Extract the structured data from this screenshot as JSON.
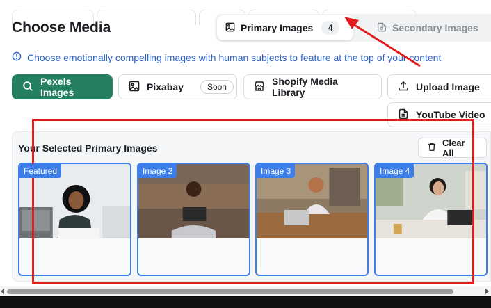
{
  "header": {
    "title": "Choose Media",
    "tabs": {
      "primary_label": "Primary Images",
      "primary_count": "4",
      "secondary_label": "Secondary Images"
    }
  },
  "info": {
    "text": "Choose emotionally compelling images with human subjects to feature at the top of your content"
  },
  "sources": {
    "pexels": "Pexels Images",
    "pixabay": "Pixabay",
    "pixabay_badge": "Soon",
    "shopify": "Shopify Media Library",
    "upload": "Upload Image",
    "youtube": "YouTube Video"
  },
  "selected": {
    "title": "Your Selected Primary Images",
    "clear_label": "Clear All",
    "images": [
      {
        "tag": "Featured"
      },
      {
        "tag": "Image 2"
      },
      {
        "tag": "Image 3"
      },
      {
        "tag": "Image 4"
      }
    ]
  },
  "colors": {
    "accent_green": "#248061",
    "card_border_blue": "#3d7ee8",
    "info_blue": "#2a62c9",
    "annotation_red": "#e11d1d"
  },
  "icons": {
    "primary_tab": "image-icon",
    "secondary_tab": "image-gear-icon",
    "info": "info-circle-icon",
    "pexels": "search-icon",
    "pixabay": "image-icon",
    "shopify": "store-icon",
    "upload": "upload-icon",
    "youtube": "document-icon",
    "clear": "trash-icon"
  }
}
